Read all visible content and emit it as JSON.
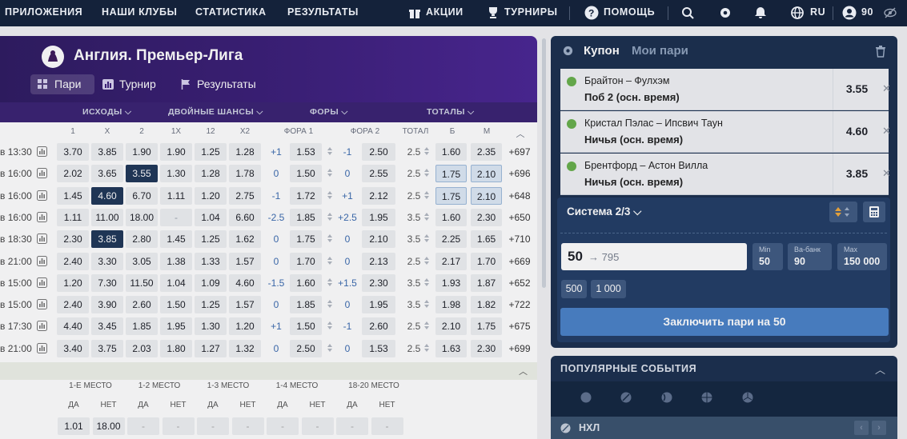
{
  "nav": {
    "items": [
      "ПРИЛОЖЕНИЯ",
      "НАШИ КЛУБЫ",
      "СТАТИСТИКА",
      "РЕЗУЛЬТАТЫ"
    ],
    "promos": "АКЦИИ",
    "tournaments": "ТУРНИРЫ",
    "help": "ПОМОЩЬ",
    "lang": "RU",
    "balance": "90",
    "icons": [
      "gift-icon",
      "trophy-icon",
      "help-icon",
      "search-icon",
      "gear-icon",
      "bell-icon",
      "globe-icon",
      "user-icon",
      "eye-off-icon"
    ]
  },
  "league": {
    "title": "Англия. Премьер-Лига",
    "tabs": [
      "Пари",
      "Турнир",
      "Результаты"
    ],
    "groups": [
      "ИСХОДЫ",
      "ДВОЙНЫЕ ШАНСЫ",
      "ФОРЫ",
      "ТОТАЛЫ"
    ],
    "columns": [
      "1",
      "X",
      "2",
      "1X",
      "12",
      "X2",
      "ФОРА 1",
      "ФОРА 2",
      "ТОТАЛ",
      "Б",
      "М"
    ],
    "rows": [
      {
        "time": "в 13:30",
        "o1": "3.70",
        "ox": "3.85",
        "o2": "1.90",
        "d1x": "1.90",
        "d12": "1.25",
        "dx2": "1.28",
        "h1": "+1",
        "h1o": "1.53",
        "h2": "-1",
        "h2o": "2.50",
        "tot": "2.5",
        "b": "1.60",
        "m": "2.35",
        "more": "+697"
      },
      {
        "time": "в 16:00",
        "o1": "2.02",
        "ox": "3.65",
        "o2": "3.55",
        "d1x": "1.30",
        "d12": "1.28",
        "dx2": "1.78",
        "h1": "0",
        "h1o": "1.50",
        "h2": "0",
        "h2o": "2.55",
        "tot": "2.5",
        "b": "1.75",
        "m": "2.10",
        "more": "+696"
      },
      {
        "time": "в 16:00",
        "o1": "1.45",
        "ox": "4.60",
        "o2": "6.70",
        "d1x": "1.11",
        "d12": "1.20",
        "dx2": "2.75",
        "h1": "-1",
        "h1o": "1.72",
        "h2": "+1",
        "h2o": "2.12",
        "tot": "2.5",
        "b": "1.75",
        "m": "2.10",
        "more": "+648"
      },
      {
        "time": "в 16:00",
        "o1": "1.11",
        "ox": "11.00",
        "o2": "18.00",
        "d1x": "-",
        "d12": "1.04",
        "dx2": "6.60",
        "h1": "-2.5",
        "h1o": "1.85",
        "h2": "+2.5",
        "h2o": "1.95",
        "tot": "3.5",
        "b": "1.60",
        "m": "2.30",
        "more": "+650"
      },
      {
        "time": "в 18:30",
        "o1": "2.30",
        "ox": "3.85",
        "o2": "2.80",
        "d1x": "1.45",
        "d12": "1.25",
        "dx2": "1.62",
        "h1": "0",
        "h1o": "1.75",
        "h2": "0",
        "h2o": "2.10",
        "tot": "3.5",
        "b": "2.25",
        "m": "1.65",
        "more": "+710"
      },
      {
        "time": "в 21:00",
        "o1": "2.40",
        "ox": "3.30",
        "o2": "3.05",
        "d1x": "1.38",
        "d12": "1.33",
        "dx2": "1.57",
        "h1": "0",
        "h1o": "1.70",
        "h2": "0",
        "h2o": "2.13",
        "tot": "2.5",
        "b": "2.17",
        "m": "1.70",
        "more": "+669"
      },
      {
        "time": "в 15:00",
        "o1": "1.20",
        "ox": "7.30",
        "o2": "11.50",
        "d1x": "1.04",
        "d12": "1.09",
        "dx2": "4.60",
        "h1": "-1.5",
        "h1o": "1.60",
        "h2": "+1.5",
        "h2o": "2.30",
        "tot": "3.5",
        "b": "1.93",
        "m": "1.87",
        "more": "+652"
      },
      {
        "time": "в 15:00",
        "o1": "2.40",
        "ox": "3.90",
        "o2": "2.60",
        "d1x": "1.50",
        "d12": "1.25",
        "dx2": "1.57",
        "h1": "0",
        "h1o": "1.85",
        "h2": "0",
        "h2o": "1.95",
        "tot": "3.5",
        "b": "1.98",
        "m": "1.82",
        "more": "+722"
      },
      {
        "time": "в 17:30",
        "o1": "4.40",
        "ox": "3.45",
        "o2": "1.85",
        "d1x": "1.95",
        "d12": "1.30",
        "dx2": "1.20",
        "h1": "+1",
        "h1o": "1.50",
        "h2": "-1",
        "h2o": "2.60",
        "tot": "2.5",
        "b": "2.10",
        "m": "1.75",
        "more": "+675"
      },
      {
        "time": "в 21:00",
        "o1": "3.40",
        "ox": "3.75",
        "o2": "2.03",
        "d1x": "1.80",
        "d12": "1.27",
        "dx2": "1.32",
        "h1": "0",
        "h1o": "2.50",
        "h2": "0",
        "h2o": "1.53",
        "tot": "2.5",
        "b": "1.63",
        "m": "2.30",
        "more": "+699"
      }
    ],
    "places": {
      "headers": [
        "1-Е МЕСТО",
        "1-2 МЕСТО",
        "1-3 МЕСТО",
        "1-4 МЕСТО",
        "18-20 МЕСТО"
      ],
      "yes": "ДА",
      "no": "НЕТ",
      "values": [
        "1.01",
        "18.00",
        "-",
        "-",
        "-",
        "-",
        "-",
        "-",
        "-",
        "-"
      ]
    }
  },
  "coupon": {
    "title": "Купон",
    "my_bets": "Мои пари",
    "bets": [
      {
        "match": "Брайтон – Фулхэм",
        "outcome": "Поб 2 (осн. время)",
        "odds": "3.55"
      },
      {
        "match": "Кристал Пэлас – Ипсвич Таун",
        "outcome": "Ничья (осн. время)",
        "odds": "4.60"
      },
      {
        "match": "Брентфорд – Астон Вилла",
        "outcome": "Ничья (осн. время)",
        "odds": "3.85"
      }
    ],
    "system": "Система 2/3",
    "stake": "50",
    "potential": "795",
    "min_label": "Min",
    "min_value": "50",
    "bank_label": "Ва-банк",
    "bank_value": "90",
    "max_label": "Max",
    "max_value": "150 000",
    "quick": [
      "500",
      "1 000"
    ],
    "place_bet": "Заключить пари на 50"
  },
  "popular": {
    "title": "ПОПУЛЯРНЫЕ СОБЫТИЯ",
    "league": "НХЛ"
  },
  "colors": {
    "nav_bg": "#14223a",
    "league_bg": "#3c1f7a",
    "coupon_bg": "#1a2f4e",
    "selected_cell": "#1f3658",
    "button": "#4a82c8"
  }
}
